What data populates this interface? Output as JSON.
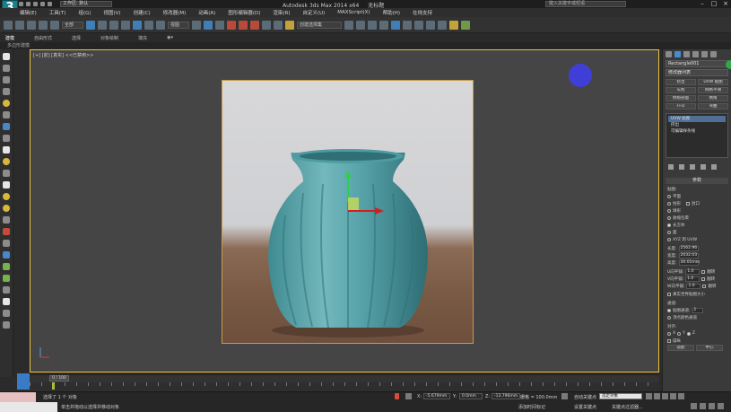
{
  "window": {
    "title": "Autodesk 3ds Max  2014 x64",
    "filename": "无标题",
    "workspace": "工作区: 默认",
    "search_placeholder": "键入关键字或短语"
  },
  "menu": [
    "编辑(E)",
    "工具(T)",
    "组(G)",
    "视图(V)",
    "创建(C)",
    "修改器(M)",
    "动画(A)",
    "图形编辑器(D)",
    "渲染(R)",
    "自定义(U)",
    "MAXScript(X)",
    "帮助(H)",
    "在线支持"
  ],
  "toolbar": {
    "selection_filter": "全部",
    "view_dropdown": "视图",
    "named_selection": "创建选择集"
  },
  "ribbon": {
    "tabs": [
      "建模",
      "自由形式",
      "选择",
      "对象绘制",
      "填充"
    ],
    "sub_label": "多边形建模"
  },
  "viewport": {
    "label": "[+] [前] [真实] <<已禁用>>"
  },
  "command_panel": {
    "object_name": "Rectangle001",
    "modifier_list": "修改器列表",
    "buttons": [
      "挤出",
      "UVW 贴图",
      "车削",
      "网格平滑",
      "倒角剖面",
      "倒角",
      "FFD",
      "弯曲"
    ],
    "stack": [
      {
        "label": "UVW 贴图",
        "selected": true
      },
      {
        "label": "挤出",
        "selected": false
      },
      {
        "label": "可编辑样条线",
        "selected": false
      }
    ],
    "params_title": "参数",
    "mapping_title": "贴图:",
    "mapping_options": [
      "平面",
      "柱形",
      "球形",
      "收缩包裹",
      "长方体",
      "面",
      "XYZ 到 UVW"
    ],
    "mapping_selected": "长方体",
    "cap_label": "封口",
    "length_label": "长度:",
    "length_value": "2562.96",
    "width_label": "宽度:",
    "width_value": "2032.03",
    "height_label": "高度:",
    "height_value": "30.01mm",
    "u_tile_label": "U向平铺:",
    "u_tile_value": "1.0",
    "v_tile_label": "V向平铺:",
    "v_tile_value": "1.0",
    "w_tile_label": "W向平铺:",
    "w_tile_value": "1.0",
    "flip_label": "翻转",
    "real_world_label": "真实世界贴图大小",
    "channel_title": "通道:",
    "map_channel_label": "贴图通道:",
    "map_channel_value": "1",
    "vertex_color_label": "顶点颜色通道",
    "alignment_title": "对齐:",
    "align_axes": [
      "X",
      "Y",
      "Z"
    ],
    "align_selected": "Z",
    "operate_label": "操纵",
    "fit_label": "适配",
    "center_label": "中心"
  },
  "timeline": {
    "slider": "0 / 100"
  },
  "status": {
    "selected": "选择了 1 个 对象",
    "prompt": "单击并拖动以选择并移动对象",
    "x_label": "X:",
    "x_value": "-5.679mm",
    "y_label": "Y:",
    "y_value": "0.0mm",
    "z_label": "Z:",
    "z_value": "-13.796mm",
    "grid": "栅格 = 100.0mm",
    "auto_key": "自动关键点",
    "set_key": "设置关键点",
    "selection_dropdown": "选定对象",
    "key_filter": "关键点过滤器...",
    "add_time_tag": "添加时间标记"
  }
}
